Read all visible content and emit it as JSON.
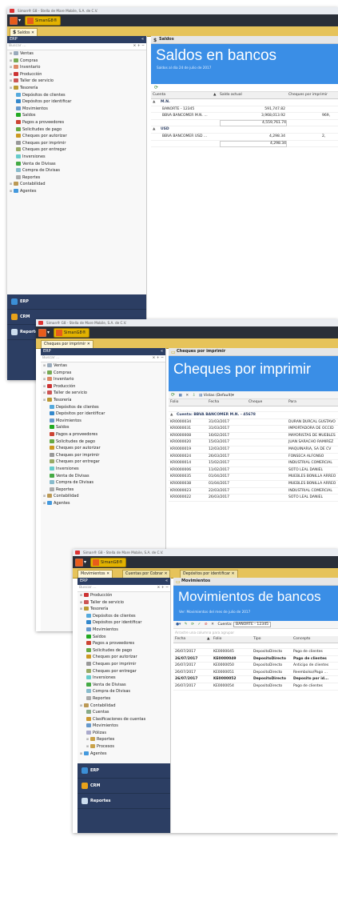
{
  "company": "Siman® G8 - Stella de Mare Mobile, S.A. de C.V.",
  "app_name": "SimanG8®",
  "w1": {
    "tab": "Saldos",
    "sidebar_title": "ERP",
    "search_placeholder": "Buscar ...",
    "search_controls": "× + −",
    "tree": [
      "Ventas",
      "Compras",
      "Inventario",
      "Producción",
      "Taller de servicio",
      "Tesorería",
      "Depósitos de clientes",
      "Depósitos por identificar",
      "Movimientos",
      "Saldos",
      "Pagos a proveedores",
      "Solicitudes de pago",
      "Cheques por autorizar",
      "Cheques por imprimir",
      "Cheques por entregar",
      "Inversiones",
      "Venta de Divisas",
      "Compra de Divisas",
      "Reportes",
      "Contabilidad",
      "Agentes"
    ],
    "nav": [
      "ERP",
      "CRM",
      "Reportes"
    ],
    "header": "Saldos",
    "banner_title": "Saldos en bancos",
    "banner_sub": "Saldos al día 24 de julio de 2017",
    "cols": [
      "Cuenta",
      "Saldo actual",
      "Cheques por imprimir"
    ],
    "group1": "M.N.",
    "rows1": [
      [
        "BANORTE - 12345",
        "591,747.82",
        ""
      ],
      [
        "BBVA BANCOMER M.N. ...",
        "3,968,013.92",
        "969,"
      ]
    ],
    "total1": "4,559,761.74",
    "group2": "USD",
    "rows2": [
      [
        "BBVA BANCOMER USD ...",
        "4,298.34",
        "2,"
      ]
    ],
    "total2": "4,298.34"
  },
  "w2": {
    "tab": "Cheques por imprimir",
    "tree": [
      "Ventas",
      "Compras",
      "Inventario",
      "Producción",
      "Taller de servicio",
      "Tesorería",
      "Depósitos de clientes",
      "Depósitos por identificar",
      "Movimientos",
      "Saldos",
      "Pagos a proveedores",
      "Solicitudes de pago",
      "Cheques por autorizar",
      "Cheques por imprimir",
      "Cheques por entregar",
      "Inversiones",
      "Venta de Divisas",
      "Compra de Divisas",
      "Reportes",
      "Contabilidad",
      "Agentes"
    ],
    "header": "Cheques por imprimir",
    "banner_title": "Cheques por imprimir",
    "view_label": "Vistas (Default)",
    "cols": [
      "Folio",
      "Fecha",
      "Cheque",
      "Para"
    ],
    "group": "Cuenta: BBVA BANCOMER M.N. - 45678",
    "rows": [
      [
        "KR0000034",
        "31/03/2017",
        "",
        "DURAN DURCAL GUSTAVO"
      ],
      [
        "KR0000031",
        "31/03/2017",
        "",
        "IMPORTADORA DE OCCID"
      ],
      [
        "KR0000008",
        "16/02/2017",
        "",
        "MAYORISTAS DE MUEBLES"
      ],
      [
        "KR0000020",
        "15/03/2017",
        "",
        "JUAN SARACHO RAMIREZ"
      ],
      [
        "KR0000019",
        "12/03/2017",
        "",
        "MAQUINARIA, SA DE CV"
      ],
      [
        "KR0000024",
        "26/03/2017",
        "",
        "FONSECA ALFONSO"
      ],
      [
        "KR0000014",
        "15/02/2017",
        "",
        "INDUSTRIAL COMERCIAL"
      ],
      [
        "KR0000006",
        "11/02/2017",
        "",
        "SOTO LEAL DANIEL"
      ],
      [
        "KR0000035",
        "01/04/2017",
        "",
        "MUEBLES BONILLA ARREO"
      ],
      [
        "KR0000038",
        "01/04/2017",
        "",
        "MUEBLES BONILLA ARREO"
      ],
      [
        "KR0000023",
        "22/03/2017",
        "",
        "INDUSTRIAL COMERCIAL"
      ],
      [
        "KR0000022",
        "26/03/2017",
        "",
        "SOTO LEAL DANIEL"
      ]
    ]
  },
  "w3": {
    "tabs": [
      "Movimientos",
      "Cuentas por Cobrar",
      "Depósitos por identificar"
    ],
    "tree": [
      "Producción",
      "Taller de servicio",
      "Tesorería",
      "Depósitos de clientes",
      "Depósitos por identificar",
      "Movimientos",
      "Saldos",
      "Pagos a proveedores",
      "Solicitudes de pago",
      "Cheques por autorizar",
      "Cheques por imprimir",
      "Cheques por entregar",
      "Inversiones",
      "Venta de Divisas",
      "Compra de Divisas",
      "Reportes",
      "Contabilidad",
      "Cuentas",
      "Clasificaciones de cuentas",
      "Movimientos",
      "Pólizas",
      "Reportes",
      "Procesos",
      "Agentes"
    ],
    "header": "Movimientos",
    "banner_title": "Movimientos de bancos",
    "banner_sub": "Ver: Movimientos del mes de julio de 2017",
    "cuenta_label": "Cuenta:",
    "cuenta_value": "BANORTE - 12345",
    "group_hint": "Arrastre una columna para agrupar",
    "cols": [
      "Fecha",
      "Folio",
      "Tipo",
      "Concepto"
    ],
    "rows": [
      [
        "26/07/2017",
        "KE0000045",
        "DepositoDirecto",
        "Pago de clientes"
      ],
      [
        "26/07/2017",
        "KE0000049",
        "DepositoDirecto",
        "Pago de clientes"
      ],
      [
        "26/07/2017",
        "KE0000050",
        "DepositoDirecto",
        "Anticipo de clientes"
      ],
      [
        "26/07/2017",
        "KE0000051",
        "DepositoDirecto",
        "Reembolso/Pago ..."
      ],
      [
        "26/07/2017",
        "KE0000052",
        "DepositoDirecto",
        "Deposito por id..."
      ],
      [
        "26/07/2017",
        "KE0000054",
        "DepositoDirecto",
        "Pago de clientes"
      ]
    ],
    "nav": [
      "ERP",
      "CRM",
      "Reportes"
    ]
  }
}
